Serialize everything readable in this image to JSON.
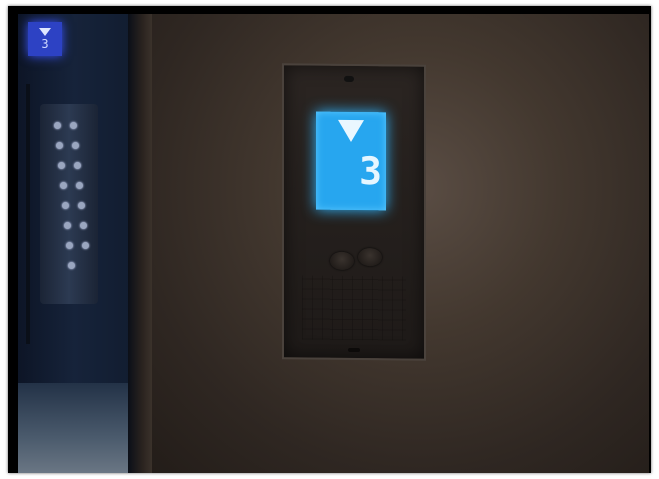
{
  "scene": {
    "left_cab_indicator": {
      "direction": "down",
      "floor": "3"
    },
    "hall_display": {
      "direction": "down",
      "floor": "3"
    }
  },
  "colors": {
    "display_blue": "#27a6ef",
    "cab_indicator_blue": "#2d42c4"
  }
}
